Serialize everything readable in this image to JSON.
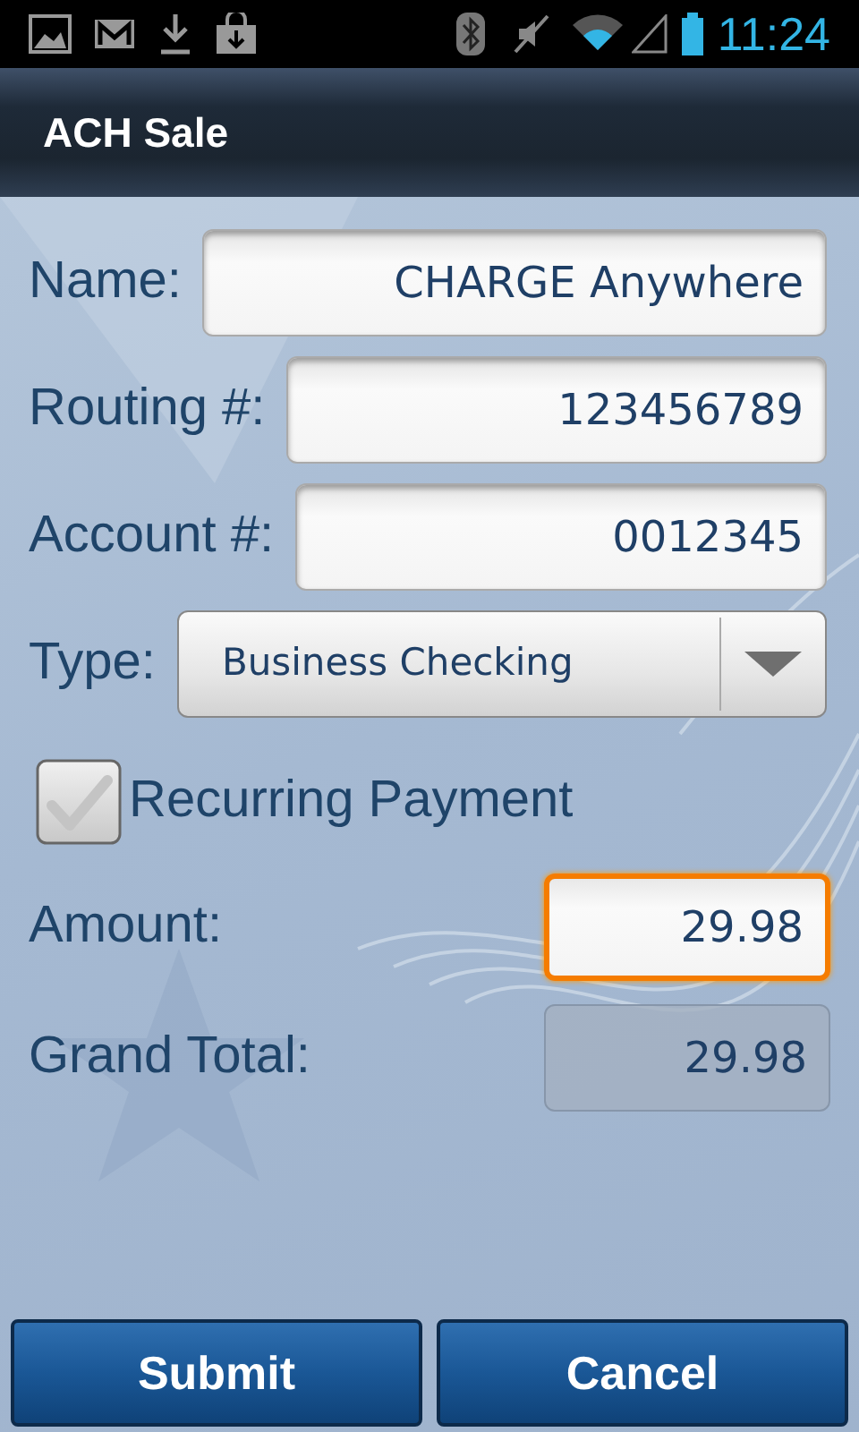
{
  "status_bar": {
    "time": "11:24"
  },
  "title": "ACH Sale",
  "fields": [
    {
      "kind": "text",
      "label": "Name:",
      "value": "CHARGE Anywhere"
    },
    {
      "kind": "text",
      "label": "Routing #:",
      "value": "123456789"
    },
    {
      "kind": "text",
      "label": "Account #:",
      "value": "0012345"
    },
    {
      "kind": "select",
      "label": "Type:",
      "value": "Business Checking"
    },
    {
      "kind": "checkbox",
      "label": "Recurring Payment",
      "checked": false
    },
    {
      "kind": "amount",
      "label": "Amount:",
      "value": "29.98",
      "focused": true,
      "disabled": false
    },
    {
      "kind": "amount",
      "label": "Grand Total:",
      "value": "29.98",
      "focused": false,
      "disabled": true
    }
  ],
  "buttons": [
    "Submit",
    "Cancel"
  ]
}
